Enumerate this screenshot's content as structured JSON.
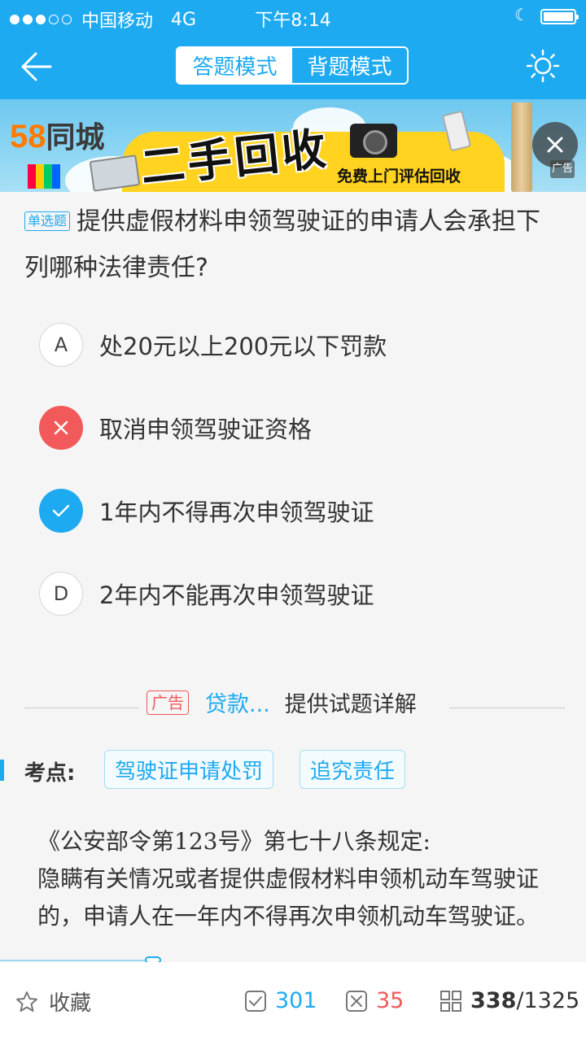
{
  "status_bar": {
    "carrier": "中国移动",
    "network": "4G",
    "time": "下午8:14"
  },
  "nav": {
    "tabs": [
      "答题模式",
      "背题模式"
    ],
    "active_tab": "答题模式"
  },
  "ad_banner": {
    "logo_num": "58",
    "logo_name": "同城",
    "headline": "二手回收",
    "subline": "免费上门评估回收",
    "ad_tag": "广告"
  },
  "question": {
    "type": "单选题",
    "text": "提供虚假材料申领驾驶证的申请人会承担下列哪种法律责任?"
  },
  "options": [
    {
      "key": "A",
      "text": "处20元以上200元以下罚款",
      "state": "none"
    },
    {
      "key": "B",
      "text": "取消申领驾驶证资格",
      "state": "wrong"
    },
    {
      "key": "C",
      "text": "1年内不得再次申领驾驶证",
      "state": "correct"
    },
    {
      "key": "D",
      "text": "2年内不能再次申领驾驶证",
      "state": "none"
    }
  ],
  "explain_bar": {
    "ad_badge": "广告",
    "ad_text": "贷款...",
    "label": "提供试题详解"
  },
  "kaodian": {
    "label": "考点:",
    "tags": [
      "驾驶证申请处罚",
      "追究责任"
    ]
  },
  "analysis": {
    "line1": "《公安部令第123号》第七十八条规定:",
    "line2": "隐瞒有关情况或者提供虚假材料申领机动车驾驶证的，申请人在一年内不得再次申领机动车驾驶证。"
  },
  "bottom_bar": {
    "favorite_label": "收藏",
    "correct_count": "301",
    "wrong_count": "35",
    "current": "338",
    "separator": "/",
    "total": "1325"
  },
  "colors": {
    "primary": "#1eaaf1",
    "wrong": "#f1595a",
    "background": "#f5f5f5"
  },
  "icons": [
    "back-arrow-icon",
    "brightness-sun-icon",
    "close-icon",
    "wrong-x-icon",
    "check-icon",
    "star-icon",
    "correct-box-icon",
    "wrong-box-icon",
    "grid-icon"
  ]
}
